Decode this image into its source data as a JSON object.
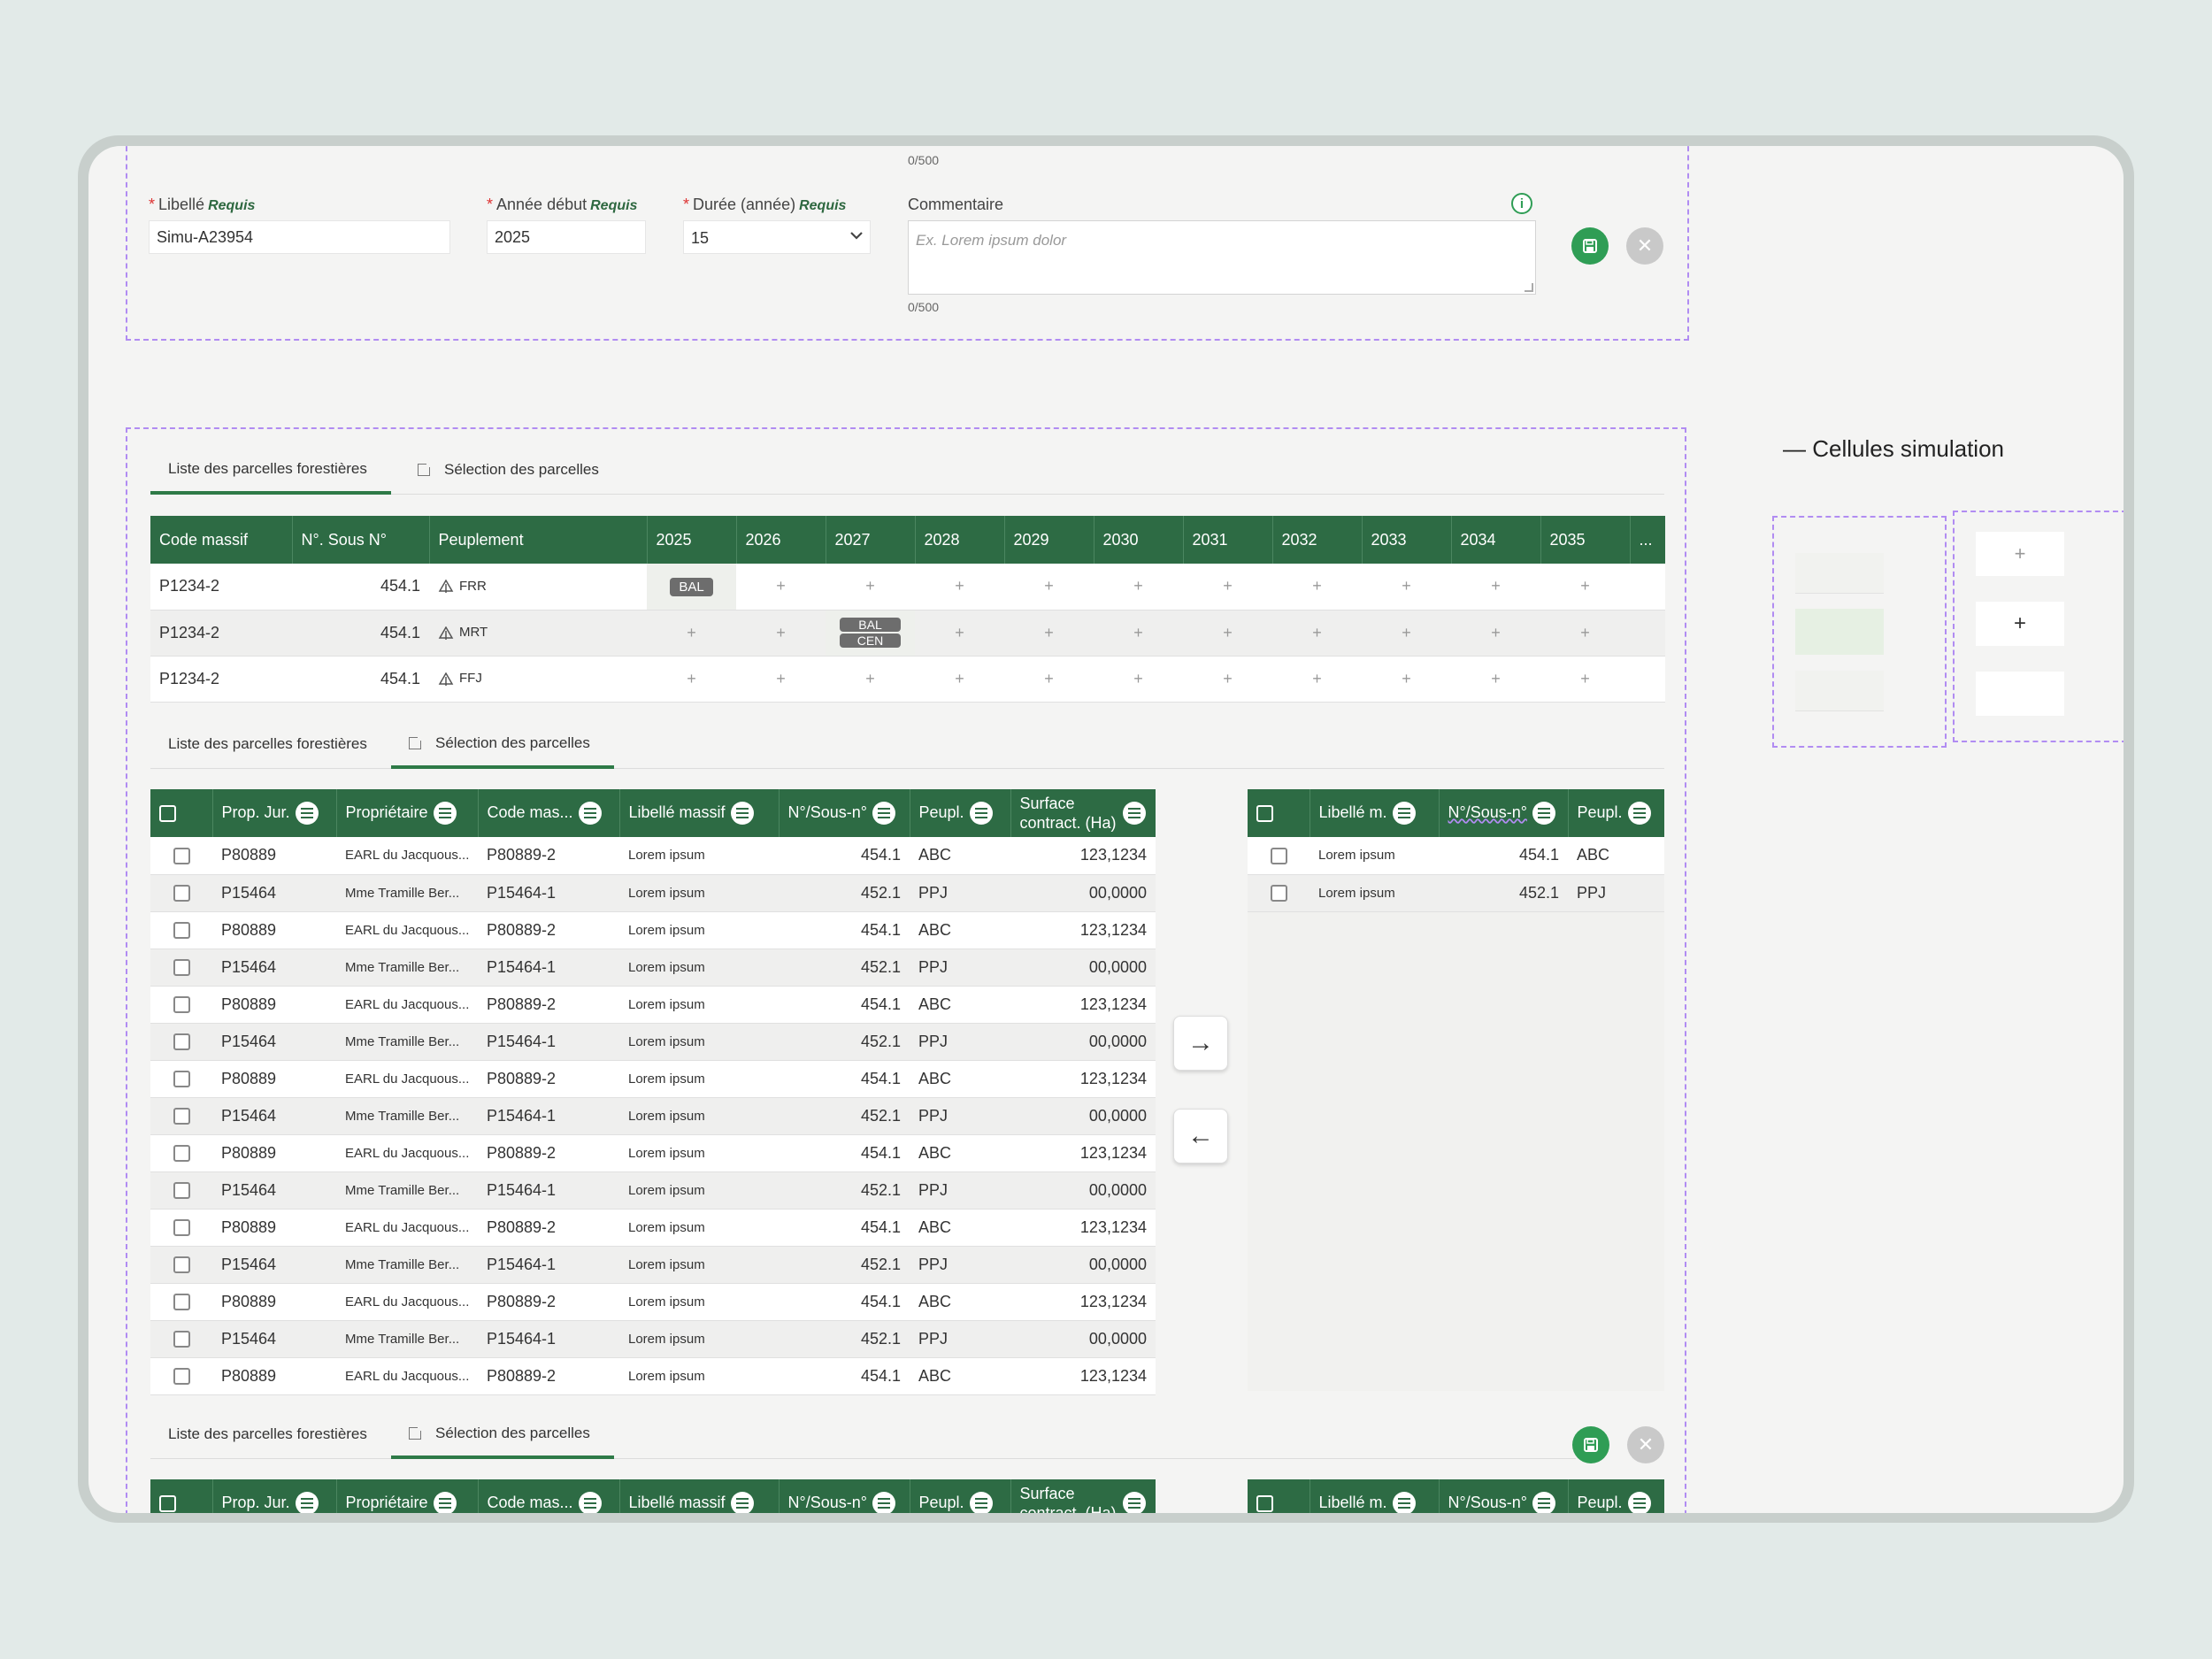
{
  "form": {
    "top_counter": "0/500",
    "libelle": {
      "label": "Libellé",
      "required": "Requis",
      "value": "Simu-A23954"
    },
    "annee": {
      "label": "Année début",
      "required": "Requis",
      "value": "2025"
    },
    "duree": {
      "label": "Durée (année)",
      "required": "Requis",
      "value": "15"
    },
    "commentaire": {
      "label": "Commentaire",
      "placeholder": "Ex. Lorem ipsum dolor",
      "counter": "0/500"
    },
    "info_icon": "info-icon",
    "save_icon": "save-icon",
    "close_icon": "close-icon",
    "close_glyph": "✕",
    "required_mark": "*",
    "info_glyph": "i"
  },
  "tabs": {
    "liste": "Liste des parcelles forestières",
    "selection": "Sélection des parcelles"
  },
  "planning": {
    "headers": [
      "Code massif",
      "N°. Sous N°",
      "Peuplement",
      "2025",
      "2026",
      "2027",
      "2028",
      "2029",
      "2030",
      "2031",
      "2032",
      "2033",
      "2034",
      "2035",
      "..."
    ],
    "rows": [
      {
        "code": "P1234-2",
        "num": "454.1",
        "peup": "FRR"
      },
      {
        "code": "P1234-2",
        "num": "454.1",
        "peup": "MRT"
      },
      {
        "code": "P1234-2",
        "num": "454.1",
        "peup": "FFJ"
      }
    ],
    "badges": {
      "bal": "BAL",
      "cen": "CEN"
    },
    "plus": "+"
  },
  "left_table": {
    "headers": [
      "Prop. Jur.",
      "Propriétaire",
      "Code mas...",
      "Libellé massif",
      "N°/Sous-n°",
      "Peupl.",
      "Surface contract. (Ha)"
    ],
    "rows": [
      [
        "P80889",
        "EARL du Jacquous...",
        "P80889-2",
        "Lorem ipsum",
        "454.1",
        "ABC",
        "123,1234"
      ],
      [
        "P15464",
        "Mme Tramille Ber...",
        "P15464-1",
        "Lorem ipsum",
        "452.1",
        "PPJ",
        "00,0000"
      ],
      [
        "P80889",
        "EARL du Jacquous...",
        "P80889-2",
        "Lorem ipsum",
        "454.1",
        "ABC",
        "123,1234"
      ],
      [
        "P15464",
        "Mme Tramille Ber...",
        "P15464-1",
        "Lorem ipsum",
        "452.1",
        "PPJ",
        "00,0000"
      ],
      [
        "P80889",
        "EARL du Jacquous...",
        "P80889-2",
        "Lorem ipsum",
        "454.1",
        "ABC",
        "123,1234"
      ],
      [
        "P15464",
        "Mme Tramille Ber...",
        "P15464-1",
        "Lorem ipsum",
        "452.1",
        "PPJ",
        "00,0000"
      ],
      [
        "P80889",
        "EARL du Jacquous...",
        "P80889-2",
        "Lorem ipsum",
        "454.1",
        "ABC",
        "123,1234"
      ],
      [
        "P15464",
        "Mme Tramille Ber...",
        "P15464-1",
        "Lorem ipsum",
        "452.1",
        "PPJ",
        "00,0000"
      ],
      [
        "P80889",
        "EARL du Jacquous...",
        "P80889-2",
        "Lorem ipsum",
        "454.1",
        "ABC",
        "123,1234"
      ],
      [
        "P15464",
        "Mme Tramille Ber...",
        "P15464-1",
        "Lorem ipsum",
        "452.1",
        "PPJ",
        "00,0000"
      ],
      [
        "P80889",
        "EARL du Jacquous...",
        "P80889-2",
        "Lorem ipsum",
        "454.1",
        "ABC",
        "123,1234"
      ],
      [
        "P15464",
        "Mme Tramille Ber...",
        "P15464-1",
        "Lorem ipsum",
        "452.1",
        "PPJ",
        "00,0000"
      ],
      [
        "P80889",
        "EARL du Jacquous...",
        "P80889-2",
        "Lorem ipsum",
        "454.1",
        "ABC",
        "123,1234"
      ],
      [
        "P15464",
        "Mme Tramille Ber...",
        "P15464-1",
        "Lorem ipsum",
        "452.1",
        "PPJ",
        "00,0000"
      ],
      [
        "P80889",
        "EARL du Jacquous...",
        "P80889-2",
        "Lorem ipsum",
        "454.1",
        "ABC",
        "123,1234"
      ]
    ]
  },
  "right_table": {
    "headers": [
      "Libellé m.",
      "N°/Sous-n°",
      "Peupl."
    ],
    "rows": [
      [
        "Lorem ipsum",
        "454.1",
        "ABC"
      ],
      [
        "Lorem ipsum",
        "452.1",
        "PPJ"
      ]
    ]
  },
  "transfer": {
    "right_arrow": "→",
    "left_arrow": "←"
  },
  "side": {
    "title": "— Cellules simulation",
    "plus": "+"
  },
  "colors": {
    "green": "#2d6b44",
    "save_green": "#2f9d55",
    "dash": "#b18cf2"
  }
}
